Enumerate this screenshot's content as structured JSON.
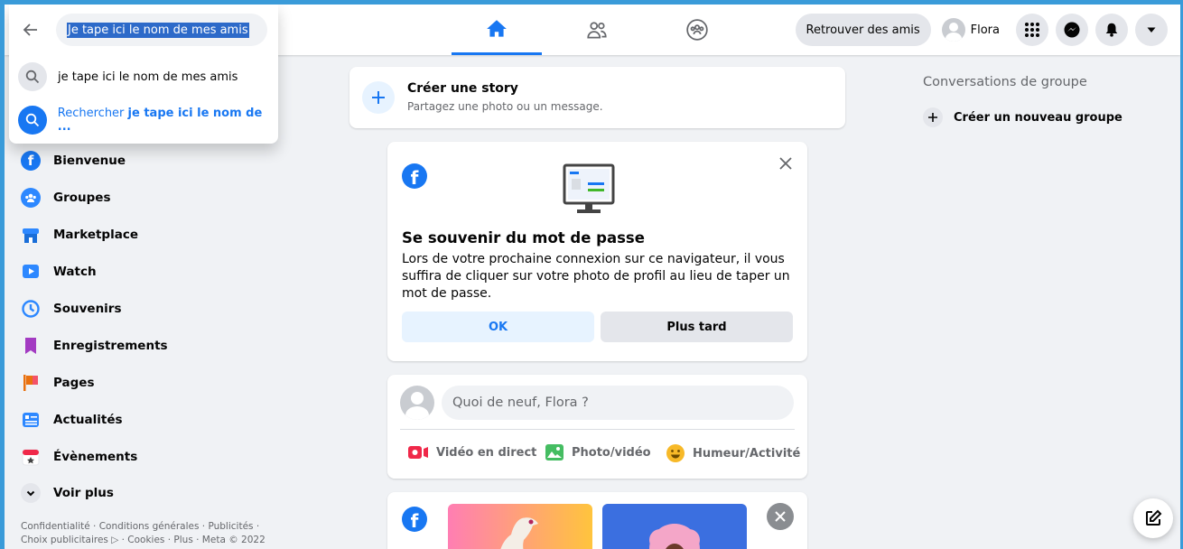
{
  "search": {
    "query": "Je tape ici le nom de mes amis",
    "suggestion": "je tape ici le nom de mes amis",
    "search_prefix": "Rechercher",
    "search_term": "je tape ici le nom de ..."
  },
  "header": {
    "find_friends": "Retrouver des amis",
    "profile_name": "Flora"
  },
  "sidebar": {
    "items": [
      {
        "label": "Bienvenue"
      },
      {
        "label": "Groupes"
      },
      {
        "label": "Marketplace"
      },
      {
        "label": "Watch"
      },
      {
        "label": "Souvenirs"
      },
      {
        "label": "Enregistrements"
      },
      {
        "label": "Pages"
      },
      {
        "label": "Actualités"
      },
      {
        "label": "Évènements"
      },
      {
        "label": "Voir plus"
      }
    ],
    "footer_line1": "Confidentialité · Conditions générales · Publicités ·",
    "footer_line2": "Choix publicitaires ▷ · Cookies · Plus · Meta © 2022"
  },
  "story": {
    "title": "Créer une story",
    "subtitle": "Partagez une photo ou un message."
  },
  "password_card": {
    "title": "Se souvenir du mot de passe",
    "body": "Lors de votre prochaine connexion sur ce navigateur, il vous suffira de cliquer sur votre photo de profil au lieu de taper un mot de passe.",
    "ok": "OK",
    "later": "Plus tard"
  },
  "composer": {
    "placeholder": "Quoi de neuf, Flora ?",
    "live_video": "Vidéo en direct",
    "photo_video": "Photo/vidéo",
    "feeling": "Humeur/Activité"
  },
  "right": {
    "group_title": "Conversations de groupe",
    "new_group": "Créer un nouveau groupe"
  },
  "colors": {
    "brand": "#1877f2",
    "frame": "#3a9bd9",
    "background": "#f0f2f5"
  }
}
